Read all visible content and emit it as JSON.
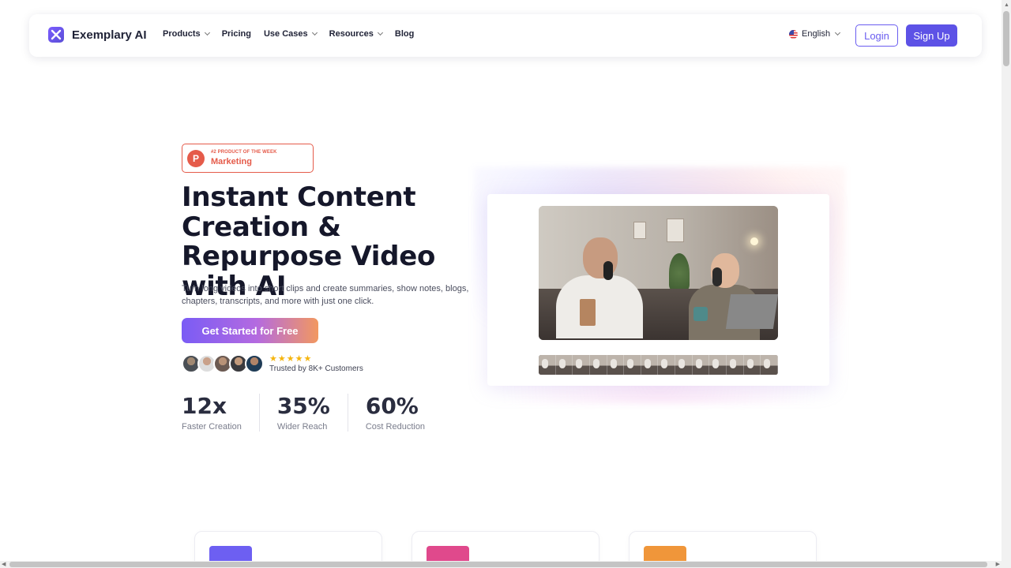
{
  "brand": {
    "name": "Exemplary AI"
  },
  "nav": {
    "links": [
      {
        "label": "Products",
        "dropdown": true
      },
      {
        "label": "Pricing",
        "dropdown": false
      },
      {
        "label": "Use Cases",
        "dropdown": true
      },
      {
        "label": "Resources",
        "dropdown": true
      },
      {
        "label": "Blog",
        "dropdown": false
      }
    ],
    "language": "English",
    "login_label": "Login",
    "signup_label": "Sign Up"
  },
  "badge": {
    "small": "#2 PRODUCT OF THE WEEK",
    "big": "Marketing",
    "letter": "P"
  },
  "hero": {
    "title": "Instant Content Creation & Repurpose Video with AI",
    "subtitle": "Turn long videos into short clips and create summaries, show notes, blogs, chapters, transcripts, and more with just one click.",
    "cta": "Get Started for Free",
    "rating_stars": 5,
    "trusted": "Trusted by 8K+ Customers"
  },
  "stats": [
    {
      "value": "12x",
      "label": "Faster Creation"
    },
    {
      "value": "35%",
      "label": "Wider Reach"
    },
    {
      "value": "60%",
      "label": "Cost Reduction"
    }
  ],
  "colors": {
    "accent": "#5d52e6",
    "badge_red": "#e55b4a",
    "star": "#f5b50f",
    "feature_icons": [
      "#6d5ff2",
      "#e0498c",
      "#f0963a"
    ]
  }
}
